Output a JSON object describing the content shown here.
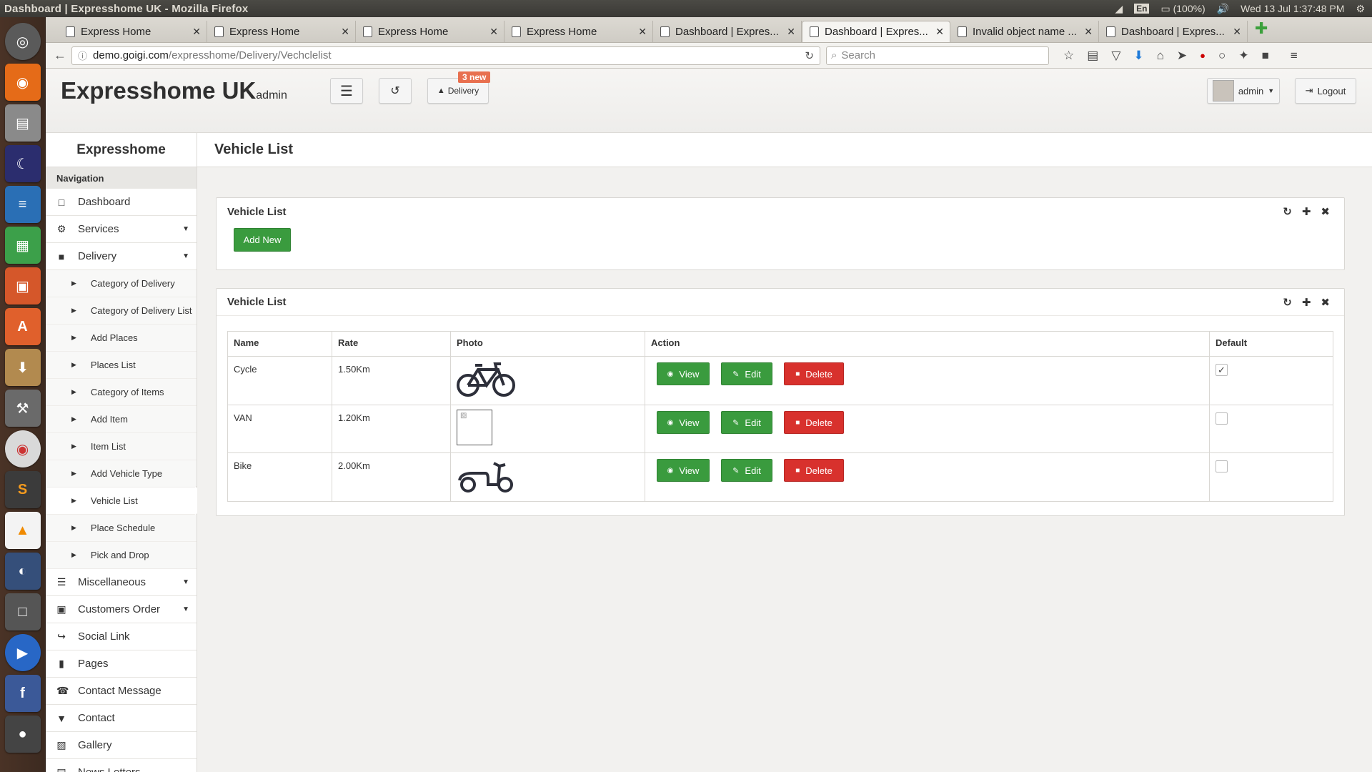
{
  "window": {
    "title": "Dashboard | Expresshome UK - Mozilla Firefox"
  },
  "tray": {
    "keyboard": "En",
    "battery": "(100%)",
    "clock": "Wed 13 Jul  1:37:48 PM"
  },
  "tabs": [
    {
      "label": "Express Home"
    },
    {
      "label": "Express Home"
    },
    {
      "label": "Express Home"
    },
    {
      "label": "Express Home"
    },
    {
      "label": "Dashboard | Expres..."
    },
    {
      "label": "Dashboard | Expres...",
      "active": true
    },
    {
      "label": "Invalid object name ..."
    },
    {
      "label": "Dashboard | Expres..."
    }
  ],
  "nav": {
    "url_domain": "demo.goigi.com",
    "url_path": "/expresshome/Delivery/Vechclelist",
    "search_placeholder": "Search"
  },
  "header": {
    "brand": "Expresshome UK",
    "brand_sub": "admin",
    "delivery_label": "Delivery",
    "badge": "3 new",
    "user": "admin",
    "logout": "Logout"
  },
  "sidebar": {
    "title": "Expresshome",
    "nav_label": "Navigation",
    "items": [
      {
        "label": "Dashboard",
        "icon": "monitor-icon"
      },
      {
        "label": "Services",
        "icon": "gear-icon"
      },
      {
        "label": "Delivery",
        "icon": "truck-icon"
      }
    ],
    "subitems": [
      {
        "label": "Category of Delivery"
      },
      {
        "label": "Category of Delivery List"
      },
      {
        "label": "Add Places"
      },
      {
        "label": "Places List"
      },
      {
        "label": "Category of Items"
      },
      {
        "label": "Add Item"
      },
      {
        "label": "Item List"
      },
      {
        "label": "Add Vehicle Type"
      },
      {
        "label": "Vehicle List",
        "active": true
      },
      {
        "label": "Place Schedule"
      },
      {
        "label": "Pick and Drop"
      }
    ],
    "items2": [
      {
        "label": "Miscellaneous",
        "icon": "list-icon"
      },
      {
        "label": "Customers Order",
        "icon": "cart-icon"
      },
      {
        "label": "Social Link",
        "icon": "share-icon"
      },
      {
        "label": "Pages",
        "icon": "file-icon"
      },
      {
        "label": "Contact Message",
        "icon": "phone-icon"
      },
      {
        "label": "Contact",
        "icon": "map-marker-icon"
      },
      {
        "label": "Gallery",
        "icon": "picture-icon"
      },
      {
        "label": "News Letters",
        "icon": "newspaper-icon"
      }
    ]
  },
  "page": {
    "title": "Vehicle List",
    "panel1": {
      "title": "Vehicle List",
      "add_button": "Add New"
    },
    "panel2": {
      "title": "Vehicle List"
    },
    "table": {
      "headers": [
        "Name",
        "Rate",
        "Photo",
        "Action",
        "Default"
      ],
      "rows": [
        {
          "name": "Cycle",
          "rate": "1.50Km",
          "photo": "bicycle-icon",
          "default": true
        },
        {
          "name": "VAN",
          "rate": "1.20Km",
          "photo": "broken-image-icon",
          "default": false
        },
        {
          "name": "Bike",
          "rate": "2.00Km",
          "photo": "scooter-icon",
          "default": false
        }
      ],
      "view_label": "View",
      "edit_label": "Edit",
      "delete_label": "Delete"
    }
  },
  "colors": {
    "green": "#3a9b3e",
    "red": "#d8312d",
    "badge": "#e8704f"
  }
}
